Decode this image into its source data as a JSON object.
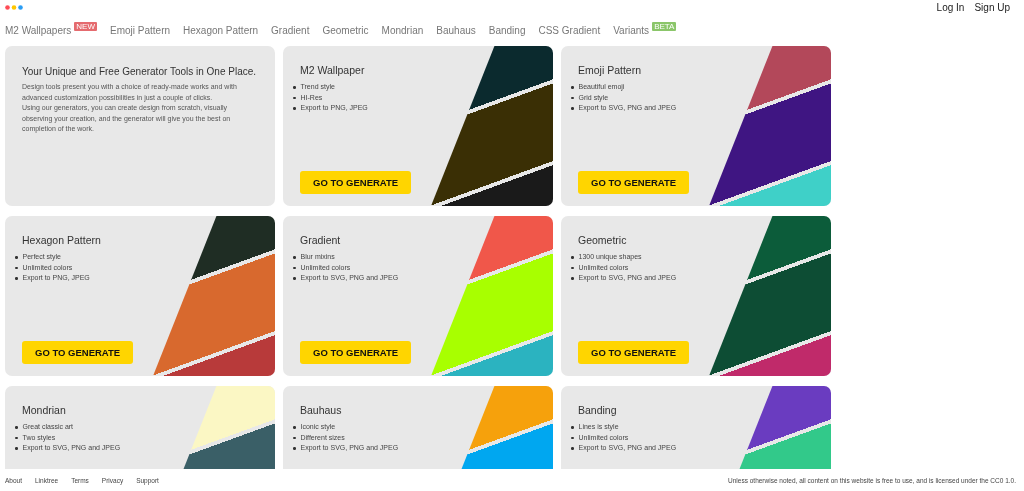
{
  "nav": [
    {
      "label": "M2 Wallpapers",
      "badge": {
        "text": "NEW",
        "kind": "new"
      }
    },
    {
      "label": "Emoji Pattern"
    },
    {
      "label": "Hexagon Pattern"
    },
    {
      "label": "Gradient"
    },
    {
      "label": "Geometric"
    },
    {
      "label": "Mondrian"
    },
    {
      "label": "Bauhaus"
    },
    {
      "label": "Banding"
    },
    {
      "label": "CSS Gradient"
    },
    {
      "label": "Variants",
      "badge": {
        "text": "BETA",
        "kind": "beta"
      }
    }
  ],
  "account": [
    "Log In",
    "Sign Up"
  ],
  "intro": {
    "title": "Your Unique and Free Generator Tools in One Place.",
    "paragraphs": [
      "Design tools present you with a choice of ready-made works and with advanced customization possibilities in just a couple of clicks.",
      "Using our generators, you can create design from scratch, visually observing your creation, and the generator will give you the best on completion of the work."
    ]
  },
  "tools": [
    {
      "title": "M2 Wallpaper",
      "features": [
        "Trend style",
        "HI-Res",
        "Export to PNG, JPEG"
      ],
      "button": "GO TO GENERATE"
    },
    {
      "title": "Emoji Pattern",
      "features": [
        "Beautiful emoji",
        "Grid style",
        "Export to SVG, PNG and JPEG"
      ],
      "button": "GO TO GENERATE"
    },
    {
      "title": "Hexagon Pattern",
      "features": [
        "Perfect style",
        "Unlimited colors",
        "Export to PNG, JPEG"
      ],
      "button": "GO TO GENERATE"
    },
    {
      "title": "Gradient",
      "features": [
        "Blur mixins",
        "Unlimited colors",
        "Export to SVG, PNG and JPEG"
      ],
      "button": "GO TO GENERATE"
    },
    {
      "title": "Geometric",
      "features": [
        "1300 unique shapes",
        "Unlimited colors",
        "Export to SVG, PNG and JPEG"
      ],
      "button": "GO TO GENERATE"
    },
    {
      "title": "Mondrian",
      "features": [
        "Great classic art",
        "Two styles",
        "Export to SVG, PNG and JPEG"
      ]
    },
    {
      "title": "Bauhaus",
      "features": [
        "Iconic style",
        "Different sizes",
        "Export to SVG, PNG and JPEG"
      ]
    },
    {
      "title": "Banding",
      "features": [
        "Lines is style",
        "Unlimited colors",
        "Export to SVG, PNG and JPEG"
      ]
    }
  ],
  "footer": {
    "links": [
      "About",
      "Linktree",
      "Terms",
      "Privacy",
      "Support"
    ],
    "notice": "Unless otherwise noted, all content on this website is free to use, and is licensed under the CC0 1.0."
  }
}
